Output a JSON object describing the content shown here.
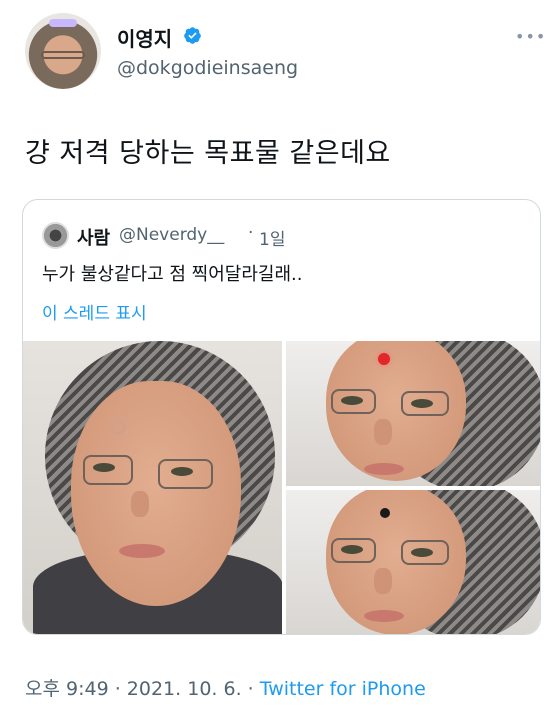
{
  "author": {
    "display_name": "이영지",
    "handle": "@dokgodieinsaeng",
    "verified_icon": "verified-badge-icon"
  },
  "tweet": {
    "text": "걍 저격 당하는 목표물 같은데요",
    "time": "오후 9:49",
    "sep1": " · ",
    "date": "2021. 10. 6.",
    "sep2": " · ",
    "source": "Twitter for iPhone"
  },
  "quoted": {
    "display_name": "사람",
    "handle": "@Neverdy__",
    "dot": "·",
    "time": "1일",
    "text": "누가 불상같다고 점 찍어달라길래..",
    "thread_link": "이 스레드 표시"
  },
  "colors": {
    "link": "#1d9bf0",
    "muted": "#536471",
    "red_dot": "#e0282b",
    "black_dot": "#1a1a1a"
  }
}
